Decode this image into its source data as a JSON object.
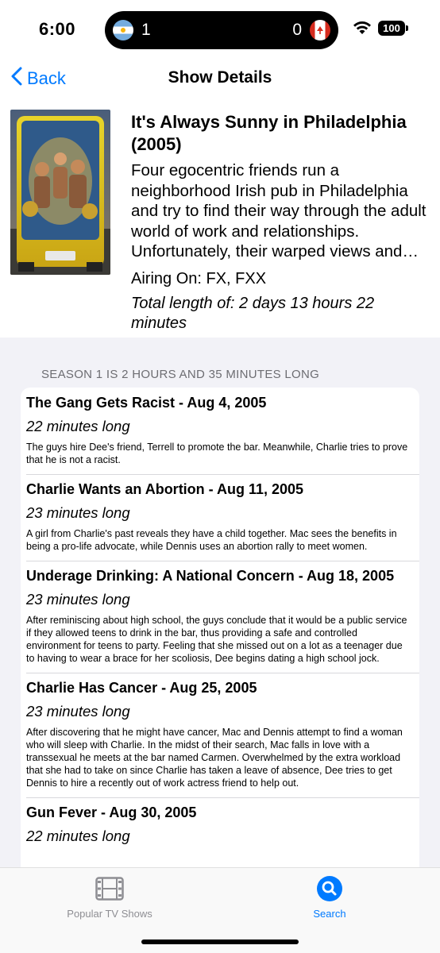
{
  "status_bar": {
    "time": "6:00",
    "score_left": "1",
    "score_right": "0",
    "battery": "100",
    "team_left_flag": "argentina-flag-icon",
    "team_right_flag": "canada-flag-icon"
  },
  "nav": {
    "back_label": "Back",
    "title": "Show Details"
  },
  "show": {
    "title": "It's Always Sunny in Philadelphia (2005)",
    "overview": "Four egocentric friends run a neighborhood Irish pub in Philadelphia and try to find their way through the adult world of work and relationships. Unfortunately, their warped views and…",
    "airing": "Airing On: FX, FXX",
    "total_length": "Total length of: 2 days 13 hours 22 minutes"
  },
  "season": {
    "header": "SEASON 1 IS  2 HOURS AND 35 MINUTES LONG",
    "episodes": [
      {
        "title": "The Gang Gets Racist - Aug 4, 2005",
        "length": "22 minutes long",
        "description": "The guys hire Dee's friend, Terrell to promote the bar.  Meanwhile, Charlie tries to prove that he is not a racist."
      },
      {
        "title": "Charlie Wants an Abortion - Aug 11, 2005",
        "length": "23 minutes long",
        "description": "A girl from Charlie's past reveals they have a child together.  Mac sees the benefits in being a pro-life advocate, while Dennis uses an abortion rally to meet women."
      },
      {
        "title": "Underage Drinking: A National Concern - Aug 18, 2005",
        "length": "23 minutes long",
        "description": "After reminiscing about high school, the guys conclude that it would be a public service if they allowed teens to drink in the bar, thus providing a safe and controlled environment for teens to party. Feeling that she missed out on a lot as a teenager due to having to wear a brace for her scoliosis, Dee begins dating a high school jock."
      },
      {
        "title": "Charlie Has Cancer - Aug 25, 2005",
        "length": "23 minutes long",
        "description": "After discovering that he might have cancer, Mac and Dennis attempt to find a woman who will sleep with Charlie.  In the midst of their search, Mac falls in love with a transsexual he meets at the bar named Carmen.  Overwhelmed by the extra workload that she had to take on since Charlie has taken a leave of absence, Dee tries to get Dennis to hire a recently out of work actress friend to help out."
      },
      {
        "title": "Gun Fever - Aug 30, 2005",
        "length": "22 minutes long",
        "description": ""
      }
    ]
  },
  "tabbar": {
    "popular_label": "Popular TV Shows",
    "search_label": "Search"
  },
  "colors": {
    "accent": "#007aff",
    "grouped_background": "#f2f2f7",
    "secondary_text": "#6d6d72",
    "tab_inactive": "#8e8e93"
  }
}
